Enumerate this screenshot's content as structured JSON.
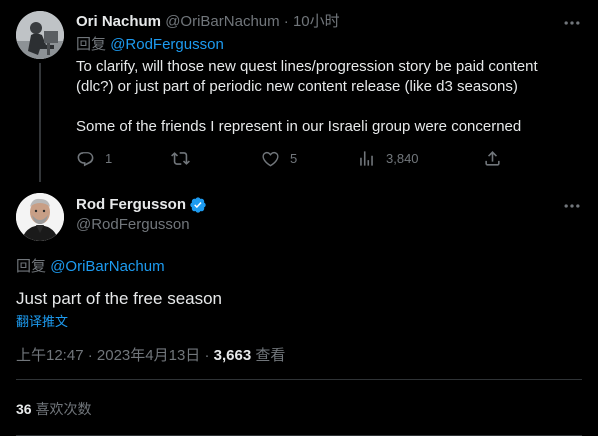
{
  "reply_tweet": {
    "author": {
      "display_name": "Ori Nachum",
      "handle": "@OriBarNachum",
      "separator": "·",
      "time": "10小时"
    },
    "replying_prefix": "回复",
    "replying_to": "@RodFergusson",
    "text_lines": [
      "To clarify, will those new quest lines/progression story be paid content (dlc?) or just part of periodic new content release (like d3 seasons)",
      "Some of the friends I represent in our Israeli group were concerned"
    ],
    "actions": {
      "replies": "1",
      "retweets": "",
      "likes": "5",
      "views": "3,840"
    },
    "icons": {
      "reply": "reply-icon",
      "retweet": "retweet-icon",
      "like": "heart-icon",
      "views": "views-icon",
      "share": "share-icon",
      "more": "more-icon"
    }
  },
  "main_tweet": {
    "author": {
      "display_name": "Rod Fergusson",
      "handle": "@RodFergusson",
      "verified": true
    },
    "replying_prefix": "回复",
    "replying_to": "@OriBarNachum",
    "text": "Just part of the free season",
    "translate_label": "翻译推文",
    "meta": {
      "time": "上午12:47",
      "separator": "·",
      "date": "2023年4月13日",
      "separator2": "·",
      "views_count": "3,663",
      "views_label": "查看"
    },
    "likes": {
      "count": "36",
      "label": "喜欢次数"
    }
  },
  "colors": {
    "background": "#000000",
    "text": "#e7e9ea",
    "muted": "#71767b",
    "link": "#1d9bf0",
    "divider": "#2f3336",
    "verified": "#1d9bf0"
  }
}
